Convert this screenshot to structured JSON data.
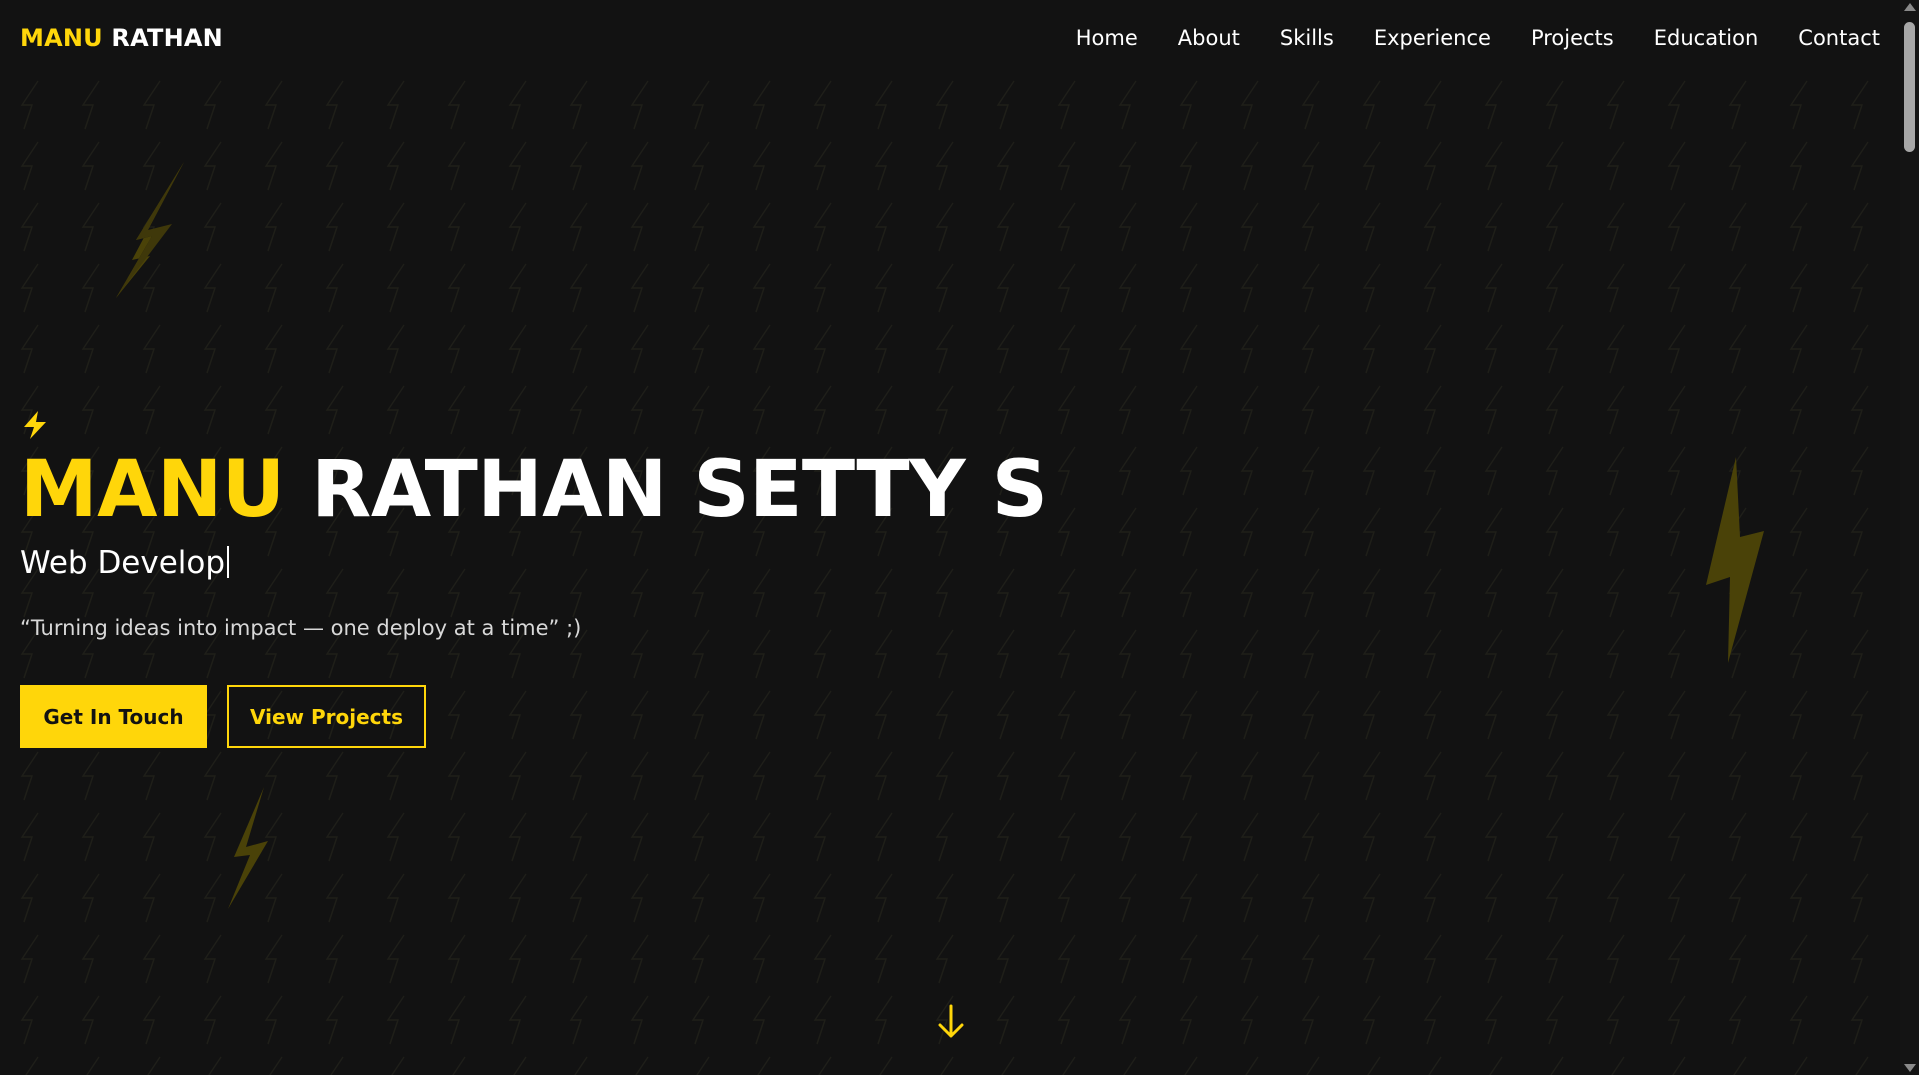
{
  "colors": {
    "background": "#121212",
    "accent": "#ffd60a",
    "text": "#ffffff"
  },
  "logo": {
    "first": "MANU",
    "last": "RATHAN"
  },
  "nav": {
    "items": [
      {
        "label": "Home"
      },
      {
        "label": "About"
      },
      {
        "label": "Skills"
      },
      {
        "label": "Experience"
      },
      {
        "label": "Projects"
      },
      {
        "label": "Education"
      },
      {
        "label": "Contact"
      }
    ]
  },
  "hero": {
    "bolt_icon": "lightning-bolt-icon",
    "title_first": "MANU",
    "title_rest": "RATHAN SETTY S",
    "subtitle": "Web Develop",
    "quote": "“Turning ideas into impact — one deploy at a time” ;)",
    "primary_button": "Get In Touch",
    "secondary_button": "View Projects",
    "scroll_icon": "arrow-down-icon"
  }
}
